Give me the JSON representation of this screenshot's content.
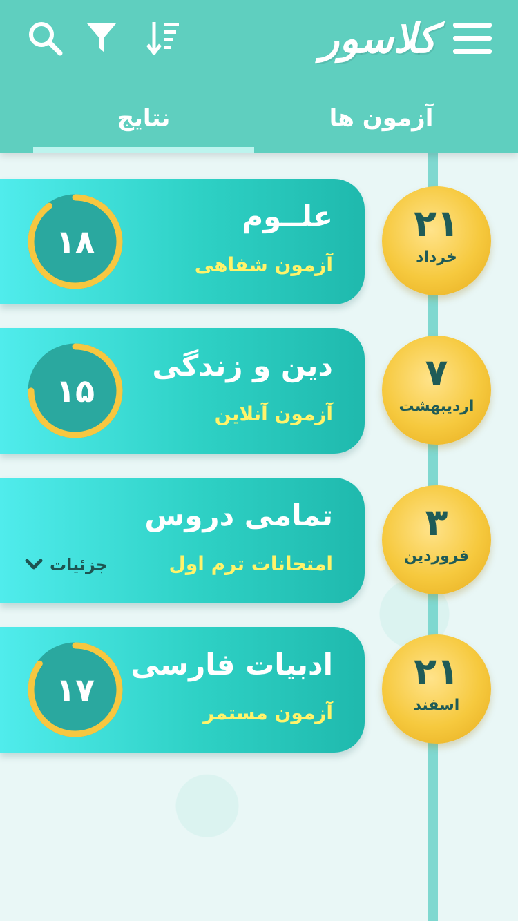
{
  "app": {
    "logo_text": "کلاسور",
    "accent_color": "#5fcfbf",
    "score_ring_color": "#f7c740"
  },
  "header": {
    "icons": [
      "search-icon",
      "filter-icon",
      "sort-icon",
      "menu-icon"
    ]
  },
  "tabs": [
    {
      "label": "نتایج",
      "active": true
    },
    {
      "label": "آزمون ها",
      "active": false
    }
  ],
  "results": [
    {
      "subject": "علــوم",
      "exam_type": "آزمون شفاهی",
      "score": "۱۸",
      "score_fraction": 0.9,
      "day": "۲۱",
      "month": "خرداد"
    },
    {
      "subject": "دین و زندگی",
      "exam_type": "آزمون آنلاین",
      "score": "۱۵",
      "score_fraction": 0.75,
      "day": "۷",
      "month": "اردیبهشت"
    },
    {
      "subject": "تمامی دروس",
      "exam_type": "امتحانات ترم اول",
      "details_label": "جزئیات",
      "day": "۳",
      "month": "فروردین"
    },
    {
      "subject": "ادبیات فارسی",
      "exam_type": "آزمون مستمر",
      "score": "۱۷",
      "score_fraction": 0.85,
      "day": "۲۱",
      "month": "اسفند"
    }
  ]
}
